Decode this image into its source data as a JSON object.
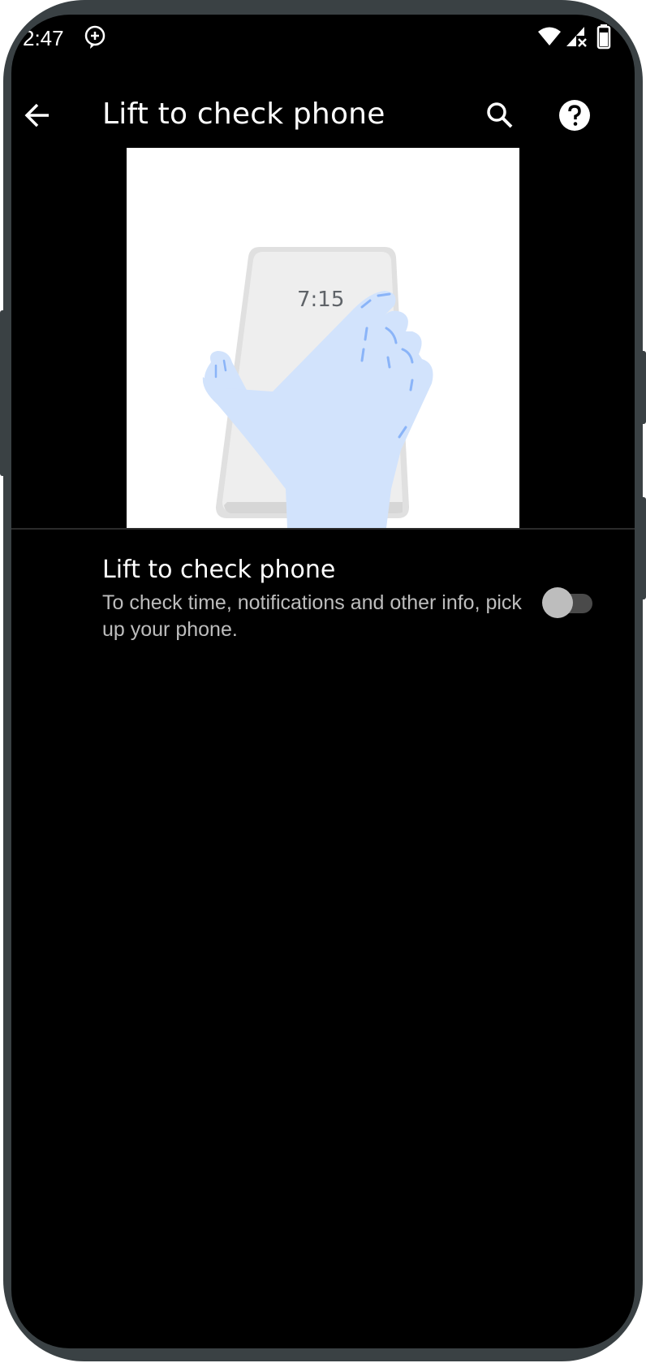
{
  "status_bar": {
    "time": "2:47",
    "icons": [
      "add-alert-icon",
      "wifi-icon",
      "signal-no-data-icon",
      "battery-icon"
    ]
  },
  "app_bar": {
    "title": "Lift to check phone",
    "back_icon": "back-arrow-icon",
    "search_icon": "search-icon",
    "help_icon": "help-icon"
  },
  "illustration": {
    "phone_clock": "7:15",
    "colors": {
      "background": "#ffffff",
      "phone": "#eeeeee",
      "hand": "#d2e3fc",
      "hand_detail": "#8ab4f8"
    }
  },
  "setting": {
    "title": "Lift to check phone",
    "summary": "To check time, notifications and other info, pick up your phone.",
    "enabled": false
  },
  "colors": {
    "frame": "#3a4144",
    "screen": "#000000",
    "text_primary": "#ffffff",
    "text_secondary": "#bdbdbd"
  }
}
